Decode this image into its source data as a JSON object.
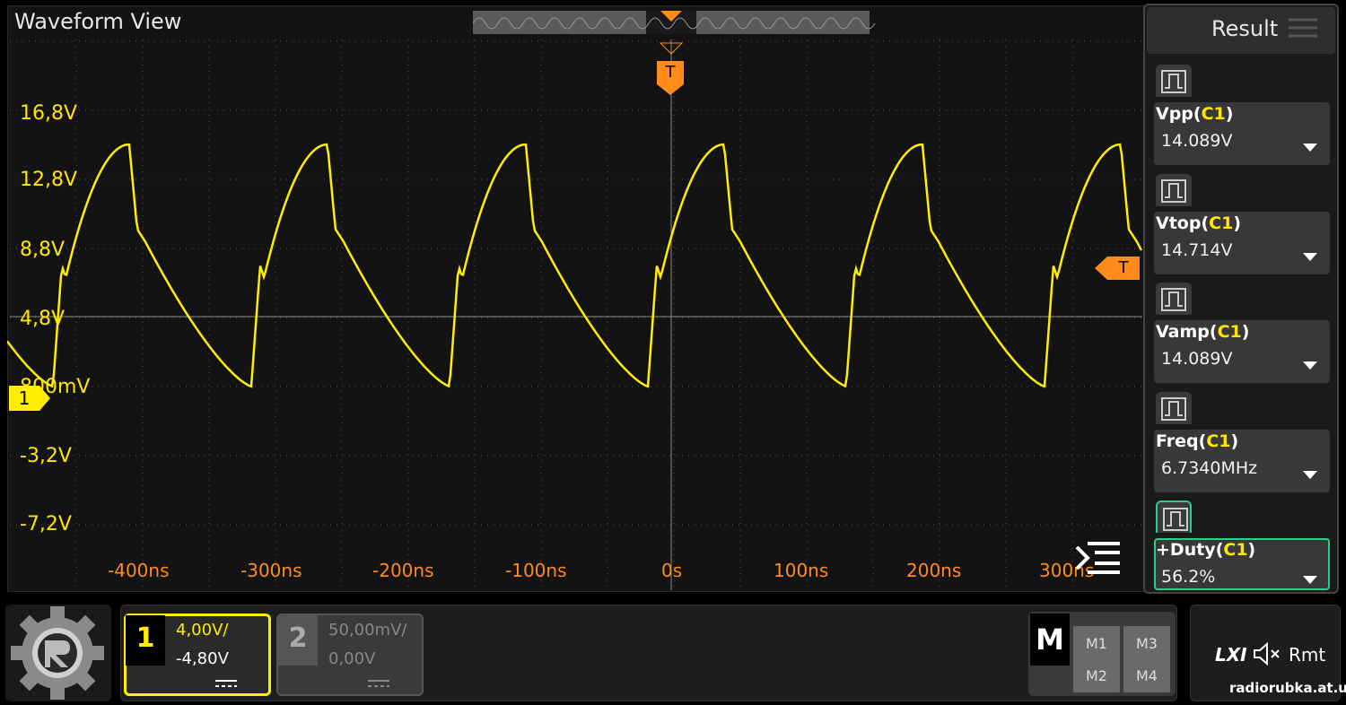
{
  "waveform": {
    "title": "Waveform View",
    "volt_labels": [
      "16,8V",
      "12,8V",
      "8,8V",
      "4,8V",
      "800mV",
      "-3,2V",
      "-7,2V"
    ],
    "time_labels": [
      "-400ns",
      "-300ns",
      "-200ns",
      "-100ns",
      "0s",
      "100ns",
      "200ns",
      "300ns"
    ],
    "trigger_label": "T",
    "channel_marker": "1",
    "colors": {
      "trace": "#ffee00",
      "trigger": "#ff8c1a",
      "grid": "#555555"
    }
  },
  "result": {
    "title": "Result",
    "measurements": [
      {
        "name": "Vpp",
        "source": "C1",
        "value": "14.089V"
      },
      {
        "name": "Vtop",
        "source": "C1",
        "value": "14.714V"
      },
      {
        "name": "Vamp",
        "source": "C1",
        "value": "14.089V"
      },
      {
        "name": "Freq",
        "source": "C1",
        "value": "6.7340MHz"
      },
      {
        "name": "+Duty",
        "source": "C1",
        "value": "56.2%"
      }
    ]
  },
  "channels": {
    "ch1": {
      "num": "1",
      "scale": "4,00V/",
      "offset": "-4,80V"
    },
    "ch2": {
      "num": "2",
      "scale": "50,00mV/",
      "offset": "0,00V"
    }
  },
  "math": {
    "label": "M",
    "buttons": [
      "M1",
      "M3",
      "M2",
      "M4"
    ]
  },
  "status": {
    "lxi": "LXI",
    "rmt": "Rmt"
  },
  "watermark": "radiorubka.at.ua"
}
